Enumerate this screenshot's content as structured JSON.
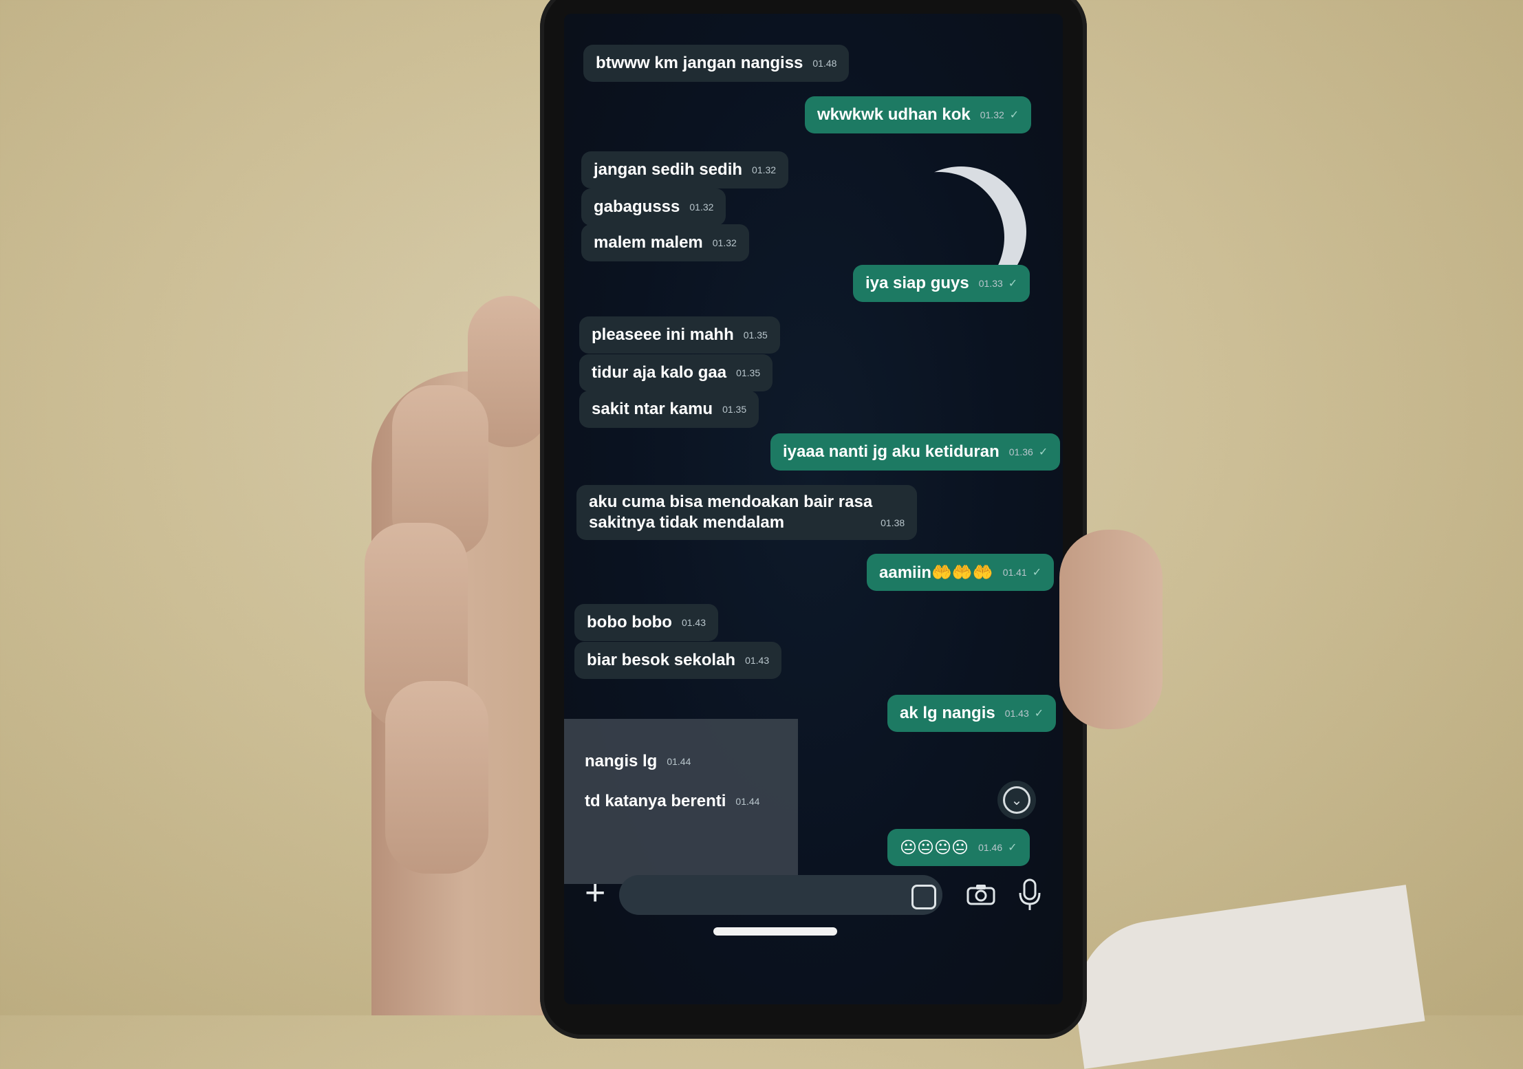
{
  "chat": {
    "messages": [
      {
        "dir": "in",
        "text": "btwww km jangan nangiss",
        "time": "01.48"
      },
      {
        "dir": "out",
        "text": "wkwkwk udhan kok",
        "time": "01.32",
        "ticks": "✓"
      },
      {
        "dir": "in",
        "text": "jangan sedih sedih",
        "time": "01.32"
      },
      {
        "dir": "in",
        "text": "gabagusss",
        "time": "01.32"
      },
      {
        "dir": "in",
        "text": "malem malem",
        "time": "01.32"
      },
      {
        "dir": "out",
        "text": "iya siap guys",
        "time": "01.33",
        "ticks": "✓"
      },
      {
        "dir": "in",
        "text": "pleaseee ini mahh",
        "time": "01.35"
      },
      {
        "dir": "in",
        "text": "tidur aja kalo gaa",
        "time": "01.35"
      },
      {
        "dir": "in",
        "text": "sakit ntar kamu",
        "time": "01.35"
      },
      {
        "dir": "out",
        "text": "iyaaa nanti jg aku ketiduran",
        "time": "01.36",
        "ticks": "✓"
      },
      {
        "dir": "in",
        "line1": "aku cuma bisa mendoakan bair rasa",
        "line2": "sakitnya tidak mendalam",
        "time": "01.38"
      },
      {
        "dir": "out",
        "text": "aamiin🤲🤲🤲",
        "time": "01.41",
        "ticks": "✓"
      },
      {
        "dir": "in",
        "text": "bobo bobo",
        "time": "01.43"
      },
      {
        "dir": "in",
        "text": "biar besok sekolah",
        "time": "01.43"
      },
      {
        "dir": "out",
        "text": "ak lg nangis",
        "time": "01.43",
        "ticks": "✓"
      },
      {
        "dir": "in",
        "text": "nangis lg",
        "time": "01.44"
      },
      {
        "dir": "in",
        "text": "td katanya berenti",
        "time": "01.44"
      },
      {
        "dir": "out",
        "text": "😐😐😐😐",
        "time": "01.46",
        "ticks": "✓"
      }
    ]
  },
  "composer": {
    "plus_icon": "plus-icon",
    "sticker_icon": "sticker-icon",
    "camera_icon": "camera-icon",
    "mic_icon": "mic-icon"
  },
  "scroll_down_icon": "chevron-down-icon",
  "colors": {
    "incoming_bubble": "#202c33",
    "outgoing_bubble": "#1d7a63",
    "chat_background": "#0a1220",
    "wall": "#cdbf97"
  }
}
